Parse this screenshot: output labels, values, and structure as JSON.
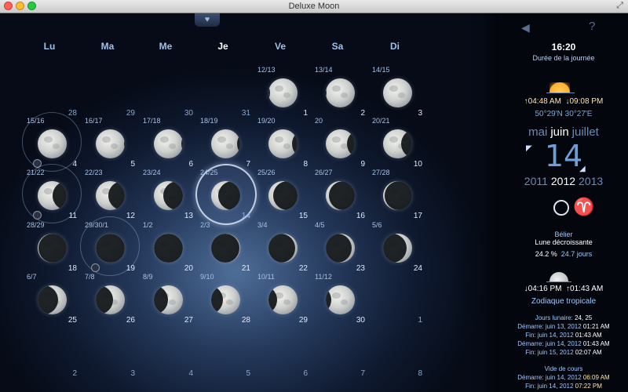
{
  "window": {
    "title": "Deluxe Moon"
  },
  "weekdays": [
    "Lu",
    "Ma",
    "Me",
    "Je",
    "Ve",
    "Sa",
    "Di"
  ],
  "calendar": {
    "weeks": [
      [
        {
          "lunar": "",
          "day": "28",
          "phase": "none"
        },
        {
          "lunar": "",
          "day": "29",
          "phase": "none"
        },
        {
          "lunar": "",
          "day": "30",
          "phase": "none"
        },
        {
          "lunar": "",
          "day": "31",
          "phase": "none"
        },
        {
          "lunar": "12/13",
          "day": "1",
          "phase": 0.95
        },
        {
          "lunar": "13/14",
          "day": "2",
          "phase": 0.98
        },
        {
          "lunar": "14/15",
          "day": "3",
          "phase": 1.0
        }
      ],
      [
        {
          "lunar": "15/16",
          "day": "4",
          "phase": 1.0,
          "ring": true
        },
        {
          "lunar": "16/17",
          "day": "5",
          "phase": 0.98
        },
        {
          "lunar": "17/18",
          "day": "6",
          "phase": 0.95
        },
        {
          "lunar": "18/19",
          "day": "7",
          "phase": 0.9
        },
        {
          "lunar": "19/20",
          "day": "8",
          "phase": 0.82
        },
        {
          "lunar": "20",
          "day": "9",
          "phase": 0.72
        },
        {
          "lunar": "20/21",
          "day": "10",
          "phase": 0.62
        }
      ],
      [
        {
          "lunar": "21/22",
          "day": "11",
          "phase": 0.52,
          "ring": true
        },
        {
          "lunar": "22/23",
          "day": "12",
          "phase": 0.42
        },
        {
          "lunar": "23/24",
          "day": "13",
          "phase": 0.32
        },
        {
          "lunar": "24/25",
          "day": "14",
          "phase": 0.24,
          "selected": true
        },
        {
          "lunar": "25/26",
          "day": "15",
          "phase": 0.16
        },
        {
          "lunar": "26/27",
          "day": "16",
          "phase": 0.1
        },
        {
          "lunar": "27/28",
          "day": "17",
          "phase": 0.05
        }
      ],
      [
        {
          "lunar": "28/29",
          "day": "18",
          "phase": 0.02
        },
        {
          "lunar": "29/30/1",
          "day": "19",
          "phase": 0.0,
          "ring": true
        },
        {
          "lunar": "1/2",
          "day": "20",
          "phase": 0.01
        },
        {
          "lunar": "2/3",
          "day": "21",
          "phase": 0.03
        },
        {
          "lunar": "3/4",
          "day": "22",
          "phase": 0.07
        },
        {
          "lunar": "4/5",
          "day": "23",
          "phase": 0.12
        },
        {
          "lunar": "5/6",
          "day": "24",
          "phase": 0.2
        }
      ],
      [
        {
          "lunar": "6/7",
          "day": "25",
          "phase": 0.3
        },
        {
          "lunar": "7/8",
          "day": "26",
          "phase": 0.4
        },
        {
          "lunar": "8/9",
          "day": "27",
          "phase": 0.5
        },
        {
          "lunar": "9/10",
          "day": "28",
          "phase": 0.6
        },
        {
          "lunar": "10/11",
          "day": "29",
          "phase": 0.7
        },
        {
          "lunar": "11/12",
          "day": "30",
          "phase": 0.8
        },
        {
          "lunar": "",
          "day": "1",
          "phase": "none"
        }
      ],
      [
        {
          "lunar": "",
          "day": "2",
          "phase": "none"
        },
        {
          "lunar": "",
          "day": "3",
          "phase": "none"
        },
        {
          "lunar": "",
          "day": "4",
          "phase": "none"
        },
        {
          "lunar": "",
          "day": "5",
          "phase": "none"
        },
        {
          "lunar": "",
          "day": "6",
          "phase": "none"
        },
        {
          "lunar": "",
          "day": "7",
          "phase": "none"
        },
        {
          "lunar": "",
          "day": "8",
          "phase": "none"
        }
      ]
    ]
  },
  "panel": {
    "time": "16:20",
    "time_caption": "Durée de la journée",
    "sunrise": "04:48 AM",
    "sunset": "09:08 PM",
    "coords": "50°29'N 30°27'E",
    "months": [
      "mai",
      "juin",
      "juillet"
    ],
    "day": "14",
    "years": [
      "2011",
      "2012",
      "2013"
    ],
    "zodiac_sign": "Bélier",
    "moon_state": "Lune décroissante",
    "illumination": "24.2 %",
    "moon_age": "24.7 jours",
    "moonset": "04:16 PM",
    "moonrise": "01:43 AM",
    "zodiac_type": "Zodiaque tropicale",
    "lunar_days_label": "Jours lunaire:",
    "lunar_days_value": "24, 25",
    "lunar_day_rows": [
      {
        "label": "Démarre: juin 13, 2012",
        "time": "01:21 AM"
      },
      {
        "label": "Fin: juin 14, 2012",
        "time": "01:43 AM"
      },
      {
        "label": "Démarre: juin 14, 2012",
        "time": "01:43 AM"
      },
      {
        "label": "Fin: juin 15, 2012",
        "time": "02:07 AM"
      }
    ],
    "void_label": "Vide de cours",
    "void_rows": [
      {
        "label": "Démarre: juin 14, 2012",
        "time": "06:09 AM"
      },
      {
        "label": "Fin: juin 14, 2012",
        "time": "07:22 PM"
      }
    ],
    "icons": {
      "speaker": "speaker-icon",
      "help": "help-icon",
      "sun": "sun-icon",
      "crescent": "waning-crescent-icon",
      "zodiac": "ram-icon"
    },
    "colors": {
      "sunrise": "#ffe5a8",
      "accent": "#9fc7ff"
    }
  }
}
